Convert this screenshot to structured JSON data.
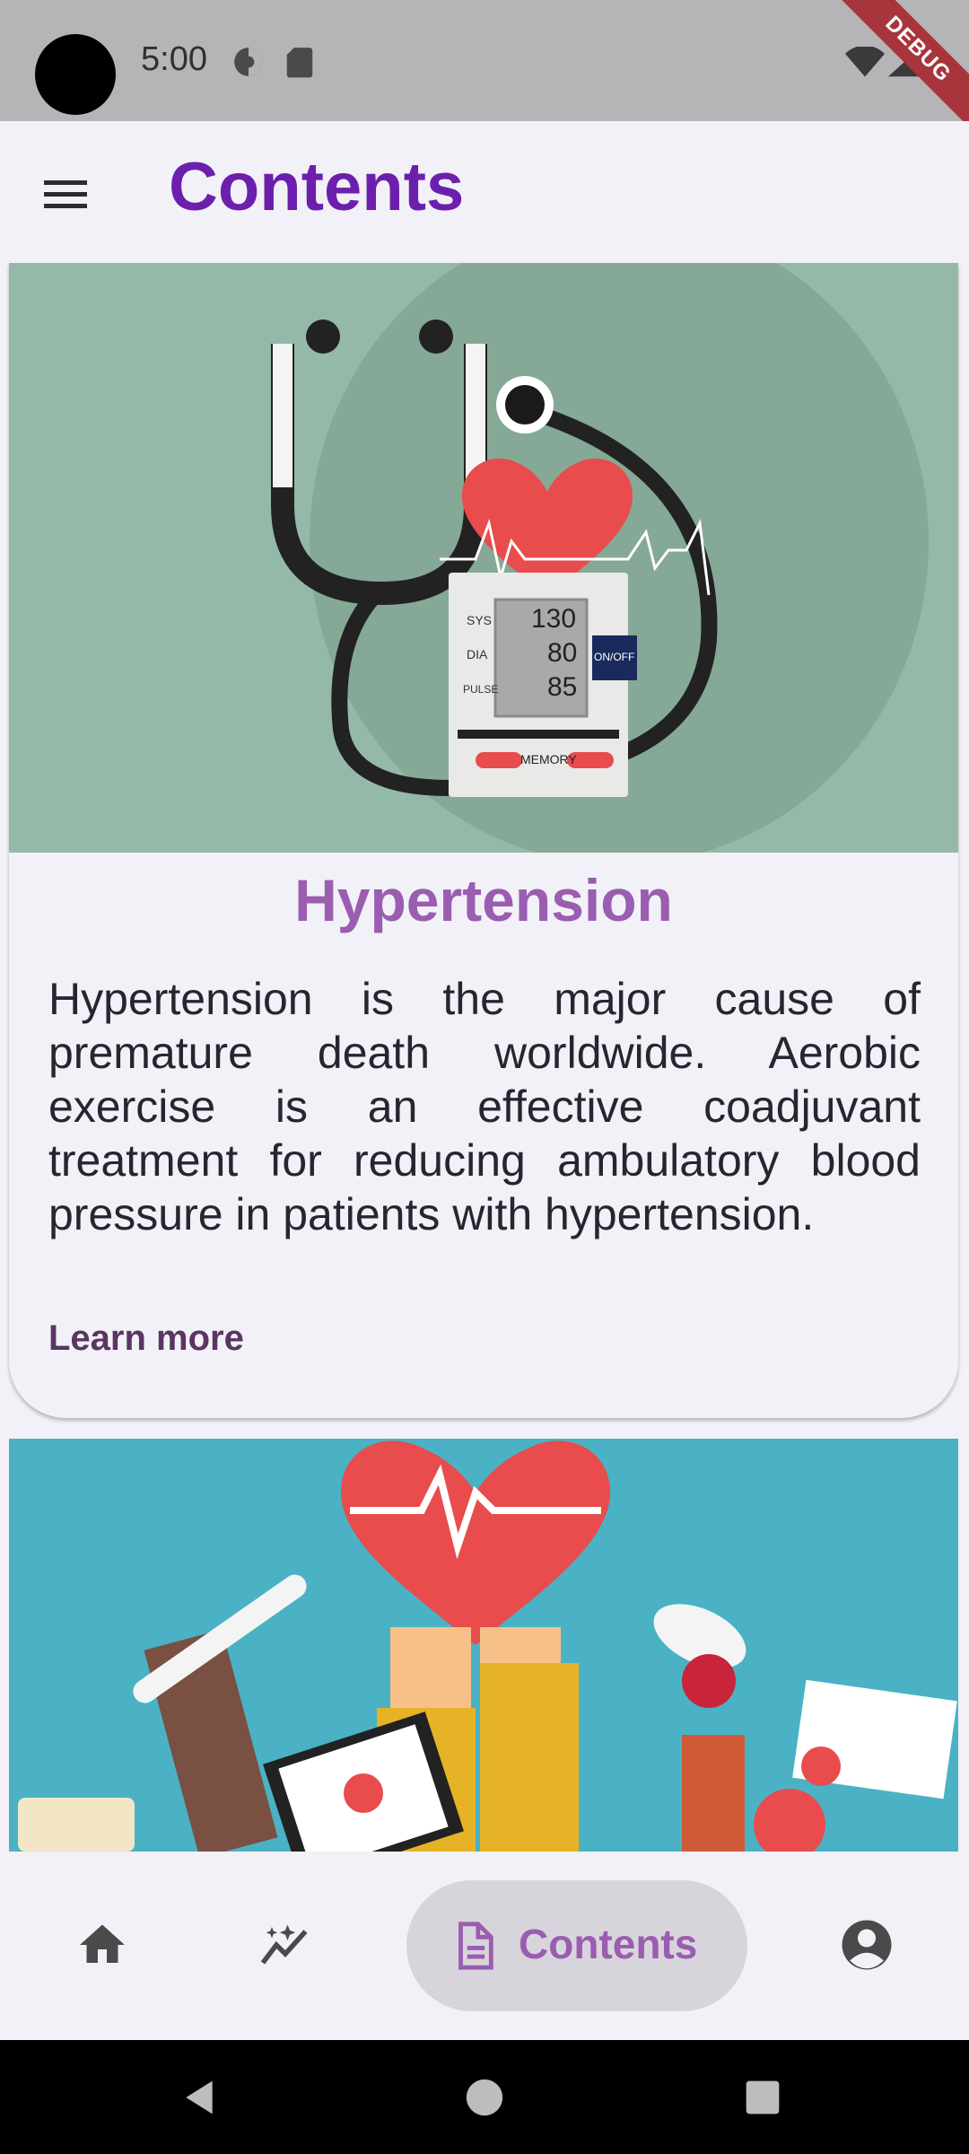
{
  "status_bar": {
    "time": "5:00",
    "debug_label": "DEBUG",
    "icons": [
      "data-saver-icon",
      "sd-card-icon",
      "wifi-icon",
      "signal-icon",
      "battery-icon"
    ]
  },
  "app_bar": {
    "title": "Contents",
    "menu_icon": "menu-icon"
  },
  "cards": [
    {
      "title": "Hypertension",
      "description": "Hypertension is the major cause of premature death worldwide. Aerobic exercise is an effective coadjuvant treatment for reducing ambulatory blood pressure in patients with hypertension.",
      "link": "Learn more",
      "image": {
        "type": "blood-pressure-illustration",
        "monitor_labels": {
          "sys": "SYS",
          "dia": "DIA",
          "pulse": "PULSE",
          "on_off": "ON/OFF",
          "memory": "MEMORY"
        },
        "readings": {
          "sys": "130",
          "dia": "80",
          "pulse": "85"
        }
      }
    },
    {
      "image": {
        "type": "healthcare-hands-illustration"
      }
    }
  ],
  "bottom_nav": {
    "items": [
      {
        "icon": "home-icon",
        "label": ""
      },
      {
        "icon": "insights-icon",
        "label": ""
      },
      {
        "icon": "document-icon",
        "label": "Contents",
        "active": true
      },
      {
        "icon": "account-circle-icon",
        "label": ""
      }
    ]
  },
  "colors": {
    "accent": "#6c1fad",
    "card_title": "#9a5db0",
    "link": "#5a3562",
    "image1_bg": "#95b9a8",
    "image2_bg": "#4ab2c4",
    "heart": "#e84c4c"
  }
}
